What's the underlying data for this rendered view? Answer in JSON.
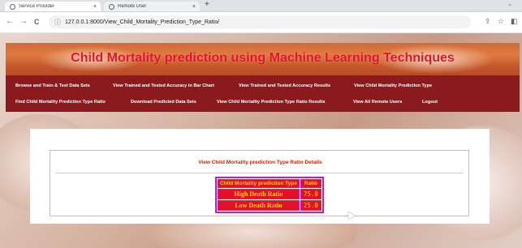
{
  "browser": {
    "tabs": [
      {
        "title": "Service Provider",
        "close": "×",
        "active": true
      },
      {
        "title": "Remote User",
        "close": "×",
        "active": false
      }
    ],
    "new_tab": "+",
    "tab_menu": "⌄",
    "url": "127.0.0.1:8000/View_Child_Mortality_Prediction_Type_Ratio/",
    "back": "←",
    "forward": "→",
    "reload": "C",
    "info": "ⓘ",
    "share": "⇪",
    "bookmark": "☆",
    "sidepanel": "◧"
  },
  "site": {
    "title": "Child Mortality prediction using Machine Learning Techniques"
  },
  "nav": {
    "row1": [
      "Browse and Train & Test Data Sets",
      "View Trained and Tested Accuracy in Bar Chart",
      "View Trained and Tested Accuracy Results",
      "View Child Mortality Prediction Type"
    ],
    "row2": [
      "Find Child Mortality Prediction Type Ratio",
      "Download Predicted Data Sets",
      "View Child Mortality Prediction Type Ratio Results",
      "View All Remote Users",
      "Logout"
    ]
  },
  "content": {
    "section_title": "View Child Mortality prediction Type Ratio Details",
    "table": {
      "headers": [
        "Child Mortality prediction Type",
        "Ratio"
      ],
      "rows": [
        [
          "High Death Ratio",
          "75.0"
        ],
        [
          "Low Death Ratio",
          "25.0"
        ]
      ]
    }
  },
  "colors": {
    "title": "#e4122a",
    "navbar": "#8b1a1e",
    "table_bg": "#e4102a",
    "table_text": "#ffd400",
    "table_border": "#c21bc2"
  },
  "icons": [
    "back-arrow-icon",
    "forward-arrow-icon",
    "reload-icon",
    "info-icon",
    "share-icon",
    "star-icon",
    "side-panel-icon",
    "cursor-icon"
  ]
}
